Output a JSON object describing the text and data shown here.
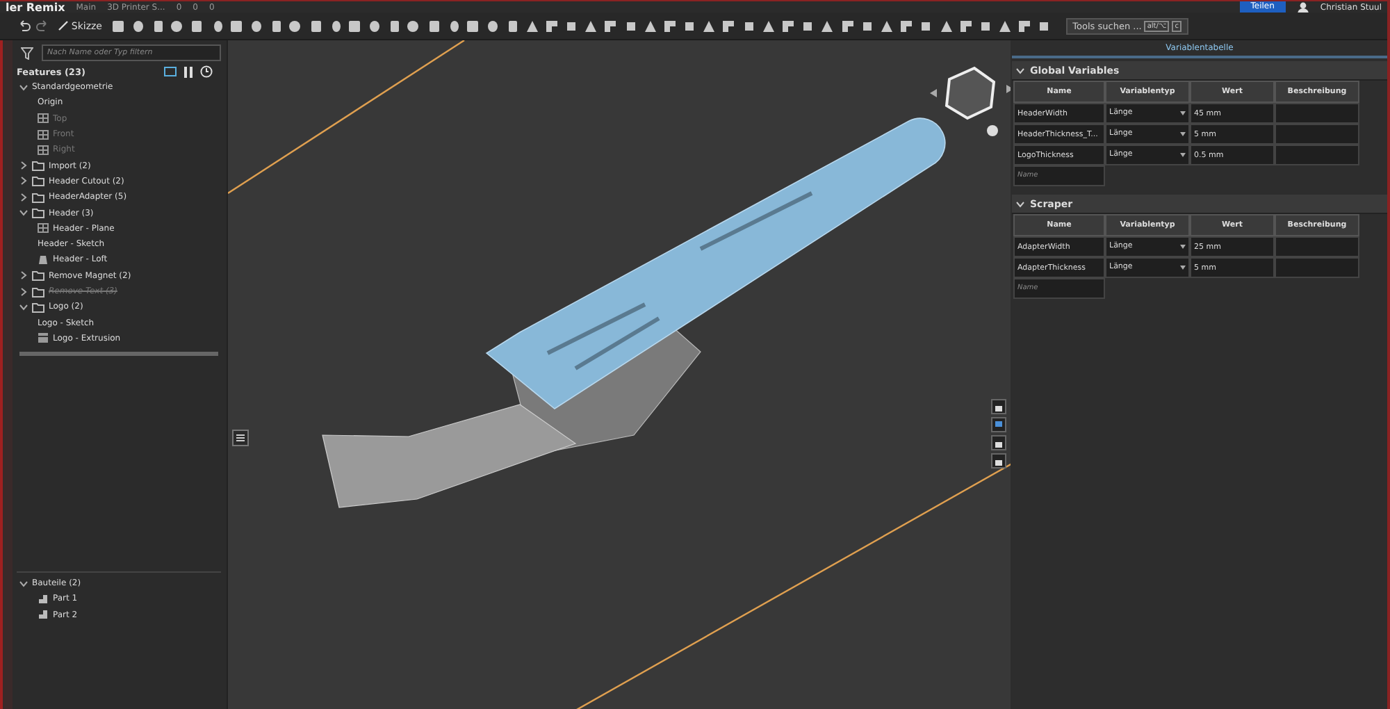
{
  "document": {
    "title": "ler Remix",
    "branch": "Main",
    "workspace": "3D Printer S...",
    "counts": [
      "0",
      "0",
      "0"
    ],
    "share_button": "Teilen",
    "user": "Christian Stuul"
  },
  "toolbar": {
    "sketch_button": "Skizze",
    "search": {
      "placeholder": "Tools suchen ...",
      "shortcut_1": "alt/⌥",
      "shortcut_2": "c"
    }
  },
  "feature_panel": {
    "filter": {
      "placeholder": "Nach Name oder Typ filtern"
    },
    "title": "Features (23)",
    "tree": [
      {
        "label": "Standardgeometrie",
        "kind": "group",
        "expanded": true,
        "disabled": false,
        "children": [
          {
            "label": "Origin",
            "kind": "origin",
            "disabled": false
          },
          {
            "label": "Top",
            "kind": "plane",
            "disabled": true
          },
          {
            "label": "Front",
            "kind": "plane",
            "disabled": true
          },
          {
            "label": "Right",
            "kind": "plane",
            "disabled": true
          }
        ]
      },
      {
        "label": "Import (2)",
        "kind": "folder",
        "expanded": false,
        "disabled": false
      },
      {
        "label": "Header Cutout (2)",
        "kind": "folder",
        "expanded": false,
        "disabled": false
      },
      {
        "label": "HeaderAdapter (5)",
        "kind": "folder",
        "expanded": false,
        "disabled": false
      },
      {
        "label": "Header (3)",
        "kind": "folder",
        "expanded": true,
        "disabled": false,
        "children": [
          {
            "label": "Header - Plane",
            "kind": "plane",
            "disabled": false
          },
          {
            "label": "Header - Sketch",
            "kind": "sketch",
            "disabled": false
          },
          {
            "label": "Header - Loft",
            "kind": "loft",
            "disabled": false
          }
        ]
      },
      {
        "label": "Remove Magnet (2)",
        "kind": "folder",
        "expanded": false,
        "disabled": false
      },
      {
        "label": "Remove Text (3)",
        "kind": "folder",
        "expanded": false,
        "disabled": true
      },
      {
        "label": "Logo (2)",
        "kind": "folder",
        "expanded": true,
        "disabled": false,
        "children": [
          {
            "label": "Logo - Sketch",
            "kind": "sketch",
            "disabled": false
          },
          {
            "label": "Logo - Extrusion",
            "kind": "extrude",
            "disabled": false
          }
        ]
      }
    ],
    "parts": {
      "label": "Bauteile (2)",
      "expanded": true,
      "items": [
        "Part 1",
        "Part 2"
      ]
    }
  },
  "variable_panel": {
    "title": "Variablentabelle",
    "sections": [
      {
        "title": "Global Variables",
        "expanded": true,
        "columns": [
          "Name",
          "Variablentyp",
          "Wert",
          "Beschreibung"
        ],
        "name_placeholder": "Name",
        "rows": [
          {
            "name": "HeaderWidth",
            "type": "Länge",
            "value": "45 mm"
          },
          {
            "name": "HeaderThickness_T...",
            "type": "Länge",
            "value": "5 mm"
          },
          {
            "name": "LogoThickness",
            "type": "Länge",
            "value": "0.5 mm"
          }
        ]
      },
      {
        "title": "Scraper",
        "expanded": true,
        "columns": [
          "Name",
          "Variablentyp",
          "Wert",
          "Beschreibung"
        ],
        "name_placeholder": "Name",
        "rows": [
          {
            "name": "AdapterWidth",
            "type": "Länge",
            "value": "25 mm"
          },
          {
            "name": "AdapterThickness",
            "type": "Länge",
            "value": "5 mm"
          }
        ]
      }
    ]
  }
}
